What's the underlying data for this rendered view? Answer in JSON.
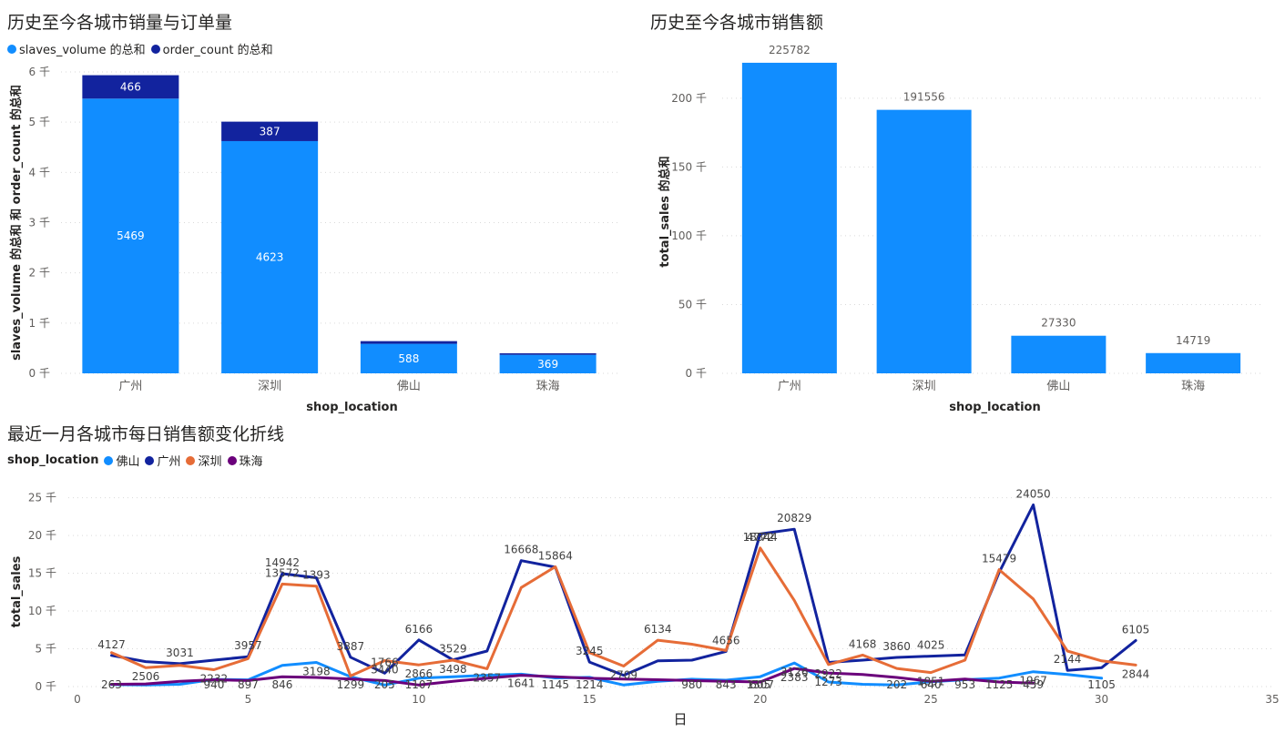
{
  "chart_data": [
    {
      "id": "chart1",
      "type": "bar",
      "stacked": true,
      "title": "历史至今各城市销量与订单量",
      "categories": [
        "广州",
        "深圳",
        "佛山",
        "珠海"
      ],
      "series": [
        {
          "name": "slaves_volume 的总和",
          "values": [
            5469,
            4623,
            588,
            369
          ],
          "color": "#118DFF"
        },
        {
          "name": "order_count 的总和",
          "values": [
            466,
            387,
            53,
            30
          ],
          "color": "#12239E"
        }
      ],
      "xlabel": "shop_location",
      "ylabel": "slaves_volume 的总和 和 order_count 的总和",
      "yticks": [
        "0 千",
        "1 千",
        "2 千",
        "3 千",
        "4 千",
        "5 千",
        "6 千"
      ],
      "ylim": [
        0,
        6000
      ],
      "legend": "top-left",
      "grid": true
    },
    {
      "id": "chart2",
      "type": "bar",
      "title": "历史至今各城市销售额",
      "categories": [
        "广州",
        "深圳",
        "佛山",
        "珠海"
      ],
      "series": [
        {
          "name": "total_sales 的总和",
          "values": [
            225782,
            191556,
            27330,
            14719
          ],
          "color": "#118DFF"
        }
      ],
      "xlabel": "shop_location",
      "ylabel": "total_sales 的总和",
      "yticks": [
        "0 千",
        "50 千",
        "100 千",
        "150 千",
        "200 千"
      ],
      "ylim": [
        0,
        235000
      ],
      "grid": true
    },
    {
      "id": "chart3",
      "type": "line",
      "title": "最近一月各城市每日销售额变化折线",
      "legend_title": "shop_location",
      "xlabel": "日",
      "ylabel": "total_sales",
      "xlim": [
        0,
        35
      ],
      "xticks": [
        "0",
        "5",
        "10",
        "15",
        "20",
        "25",
        "30",
        "35"
      ],
      "ylim": [
        0,
        27000
      ],
      "yticks": [
        "0 千",
        "5 千",
        "10 千",
        "15 千",
        "20 千",
        "25 千"
      ],
      "grid": true,
      "series": [
        {
          "name": "佛山",
          "color": "#118DFF",
          "x": [
            1,
            2,
            3,
            4,
            5,
            6,
            7,
            8,
            9,
            10,
            11,
            12,
            13,
            14,
            15,
            16,
            17,
            18,
            19,
            20,
            21,
            22,
            23,
            24,
            25,
            26,
            27,
            28,
            29,
            30
          ],
          "y": [
            263,
            200,
            300,
            940,
            897,
            2800,
            3198,
            1299,
            205,
            1107,
            1300,
            1500,
            1641,
            1145,
            1214,
            200,
            700,
            980,
            843,
            1307,
            3126,
            600,
            300,
            202,
            640,
            900,
            1125,
            1967,
            1600,
            1105
          ],
          "labels": [
            [
              1,
              263
            ],
            [
              4,
              940
            ],
            [
              5,
              897
            ],
            [
              7,
              3198
            ],
            [
              8,
              1299
            ],
            [
              9,
              205
            ],
            [
              10,
              1107
            ],
            [
              13,
              1641
            ],
            [
              14,
              1145
            ],
            [
              15,
              1214
            ],
            [
              18,
              980
            ],
            [
              19,
              843
            ],
            [
              20,
              1307
            ],
            [
              21,
              3126
            ],
            [
              24,
              202
            ],
            [
              25,
              640
            ],
            [
              27,
              1125
            ],
            [
              28,
              1967
            ],
            [
              30,
              1105
            ]
          ]
        },
        {
          "name": "广州",
          "color": "#12239E",
          "x": [
            1,
            2,
            3,
            4,
            5,
            6,
            7,
            8,
            9,
            10,
            11,
            12,
            13,
            14,
            15,
            16,
            17,
            18,
            19,
            20,
            21,
            22,
            23,
            24,
            25,
            26,
            27,
            28,
            29,
            30,
            31
          ],
          "y": [
            4127,
            3300,
            3031,
            3500,
            3957,
            14942,
            14400,
            3887,
            1766,
            6166,
            3529,
            4700,
            16668,
            15800,
            3245,
            1500,
            3400,
            3500,
            4656,
            20200,
            20829,
            3200,
            3500,
            3860,
            4025,
            4200,
            15100,
            24050,
            2144,
            2500,
            6105
          ],
          "labels": [
            [
              1,
              4127
            ],
            [
              3,
              3031
            ],
            [
              5,
              3957
            ],
            [
              6,
              14942
            ],
            [
              8,
              3887
            ],
            [
              9,
              1766
            ],
            [
              10,
              6166
            ],
            [
              11,
              3529
            ],
            [
              13,
              16668
            ],
            [
              15,
              3245
            ],
            [
              19,
              4656
            ],
            [
              21,
              20829
            ],
            [
              24,
              3860
            ],
            [
              25,
              4025
            ],
            [
              28,
              24050
            ],
            [
              29,
              2144
            ],
            [
              31,
              6105
            ]
          ]
        },
        {
          "name": "深圳",
          "color": "#E66C37",
          "x": [
            1,
            2,
            3,
            4,
            5,
            6,
            7,
            8,
            9,
            10,
            11,
            12,
            13,
            14,
            15,
            16,
            17,
            18,
            19,
            20,
            21,
            22,
            23,
            24,
            25,
            26,
            27,
            28,
            29,
            30,
            31
          ],
          "y": [
            4500,
            2506,
            2800,
            2232,
            3700,
            13572,
            13300,
            1393,
            3440,
            2866,
            3498,
            2357,
            13100,
            15864,
            4500,
            2709,
            6134,
            5600,
            4772,
            18344,
            11400,
            2922,
            4168,
            2400,
            1851,
            3500,
            15479,
            11600,
            4700,
            3400,
            2844
          ],
          "labels": [
            [
              2,
              2506
            ],
            [
              4,
              2232
            ],
            [
              6,
              13572
            ],
            [
              7,
              1393
            ],
            [
              9,
              3440
            ],
            [
              10,
              2866
            ],
            [
              11,
              3498
            ],
            [
              12,
              2357
            ],
            [
              14,
              15864
            ],
            [
              16,
              2709
            ],
            [
              17,
              6134
            ],
            [
              20,
              4772
            ],
            [
              20,
              18344
            ],
            [
              22,
              2922
            ],
            [
              23,
              4168
            ],
            [
              25,
              1851
            ],
            [
              27,
              15479
            ],
            [
              31,
              2844
            ]
          ]
        },
        {
          "name": "珠海",
          "color": "#6B007B",
          "x": [
            1,
            2,
            3,
            4,
            5,
            6,
            7,
            8,
            9,
            10,
            11,
            12,
            13,
            14,
            15,
            16,
            17,
            18,
            19,
            20,
            21,
            22,
            23,
            24,
            25,
            26,
            27,
            28
          ],
          "y": [
            300,
            350,
            700,
            900,
            800,
            1300,
            1200,
            1000,
            800,
            200,
            700,
            1100,
            1500,
            1300,
            1100,
            1000,
            900,
            800,
            700,
            605,
            2383,
            1800,
            1600,
            1200,
            700,
            1000,
            600,
            459
          ],
          "labels": [
            [
              6,
              846
            ],
            [
              20,
              605
            ],
            [
              21,
              2383
            ],
            [
              22,
              1273
            ],
            [
              26,
              953
            ],
            [
              28,
              459
            ]
          ]
        }
      ]
    }
  ]
}
